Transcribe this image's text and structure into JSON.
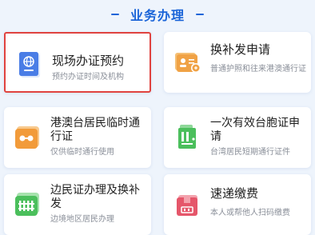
{
  "header": {
    "title": "业务办理"
  },
  "cards": [
    {
      "title": "现场办证预约",
      "subtitle": "预约办证时间及机构",
      "icon": "passport-icon",
      "color": "#4a7de6"
    },
    {
      "title": "换补发申请",
      "subtitle": "普通护照和往来港澳通行证",
      "icon": "id-card-icon",
      "color": "#f0a245"
    },
    {
      "title": "港澳台居民临时通行证",
      "subtitle": "仅供临时通行使用",
      "icon": "radio-card-icon",
      "color": "#f29b3a"
    },
    {
      "title": "一次有效台胞证申请",
      "subtitle": "台湾居民短期通行证件",
      "icon": "ticket-icon",
      "color": "#4bbf5c"
    },
    {
      "title": "边民证办理及换补发",
      "subtitle": "边境地区居民办理",
      "icon": "fence-card-icon",
      "color": "#4bbf5c"
    },
    {
      "title": "速递缴费",
      "subtitle": "本人或帮他人扫码缴费",
      "icon": "package-icon",
      "color": "#e5566a"
    }
  ]
}
